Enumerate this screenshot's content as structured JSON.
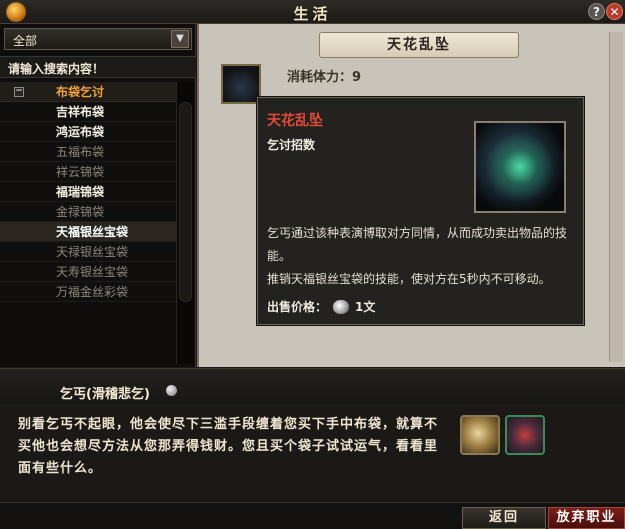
{
  "window": {
    "title": "生活"
  },
  "left": {
    "filter": "全部",
    "search_placeholder": "请输入搜索内容！",
    "category": "布袋乞讨",
    "items": [
      {
        "label": "吉祥布袋",
        "state": "on"
      },
      {
        "label": "鸿运布袋",
        "state": "on"
      },
      {
        "label": "五福布袋",
        "state": "off"
      },
      {
        "label": "祥云锦袋",
        "state": "off"
      },
      {
        "label": "福瑞锦袋",
        "state": "on"
      },
      {
        "label": "金禄锦袋",
        "state": "off"
      },
      {
        "label": "天福银丝宝袋",
        "state": "sel"
      },
      {
        "label": "天禄银丝宝袋",
        "state": "off"
      },
      {
        "label": "天寿银丝宝袋",
        "state": "off"
      },
      {
        "label": "万福金丝彩袋",
        "state": "off"
      }
    ]
  },
  "recipe": {
    "name": "天花乱坠",
    "stamina": "消耗体力：9"
  },
  "tooltip": {
    "name": "天花乱坠",
    "kind": "乞讨招数",
    "desc1": "乞丐通过该种表演博取对方同情，从而成功卖出物品的技能。",
    "desc2": "推销天福银丝宝袋的技能，使对方在5秒内不可移动。",
    "price_label": "出售价格：",
    "price_value": "1文"
  },
  "npc": {
    "name": "乞丐(滑稽悲乞)",
    "text": "别看乞丐不起眼，他会使尽下三滥手段缠着您买下手中布袋，就算不买他也会想尽方法从您那弄得钱财。您且买个袋子试试运气，看看里面有些什么。"
  },
  "buttons": {
    "back": "返回",
    "quit": "放弃职业"
  }
}
